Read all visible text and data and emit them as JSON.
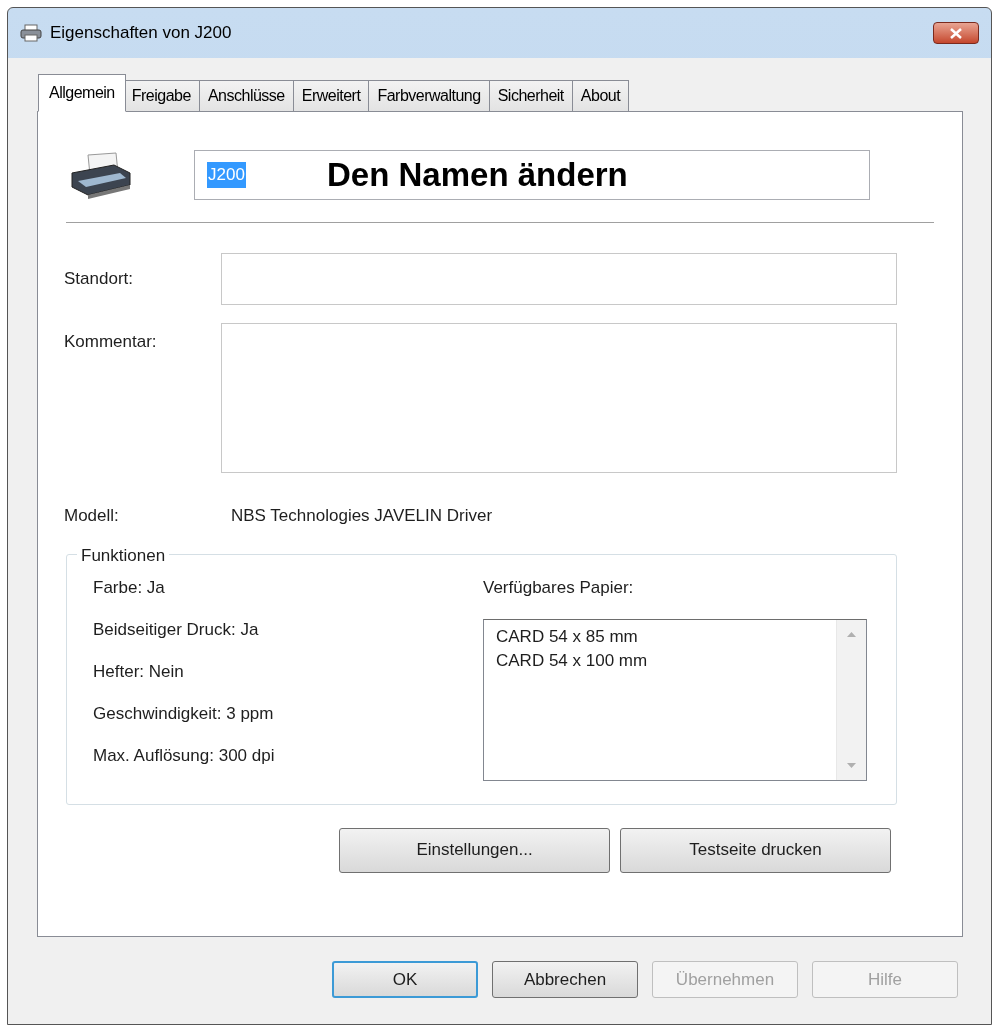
{
  "window": {
    "title": "Eigenschaften von J200"
  },
  "tabs": [
    {
      "label": "Allgemein",
      "selected": true
    },
    {
      "label": "Freigabe",
      "selected": false
    },
    {
      "label": "Anschlüsse",
      "selected": false
    },
    {
      "label": "Erweitert",
      "selected": false
    },
    {
      "label": "Farbverwaltung",
      "selected": false
    },
    {
      "label": "Sicherheit",
      "selected": false
    },
    {
      "label": "About",
      "selected": false
    }
  ],
  "name_field": {
    "value": "J200",
    "selected": true,
    "annotation": "Den Namen ändern"
  },
  "location": {
    "label": "Standort:"
  },
  "comment": {
    "label": "Kommentar:"
  },
  "model": {
    "label": "Modell:",
    "value": "NBS Technologies JAVELIN Driver"
  },
  "features": {
    "title": "Funktionen",
    "items": [
      "Farbe: Ja",
      "Beidseitiger Druck: Ja",
      "Hefter: Nein",
      "Geschwindigkeit: 3 ppm",
      "Max. Auflösung: 300 dpi"
    ],
    "paper_label": "Verfügbares Papier:",
    "paper": [
      "CARD 54 x 85 mm",
      "CARD 54 x 100 mm"
    ]
  },
  "panel_buttons": [
    {
      "label": "Einstellungen..."
    },
    {
      "label": "Testseite drucken"
    }
  ],
  "buttons": [
    {
      "label": "OK",
      "kind": "default",
      "disabled": false
    },
    {
      "label": "Abbrechen",
      "kind": "normal",
      "disabled": false
    },
    {
      "label": "Übernehmen",
      "kind": "normal",
      "disabled": true
    },
    {
      "label": "Hilfe",
      "kind": "normal",
      "disabled": true
    }
  ]
}
